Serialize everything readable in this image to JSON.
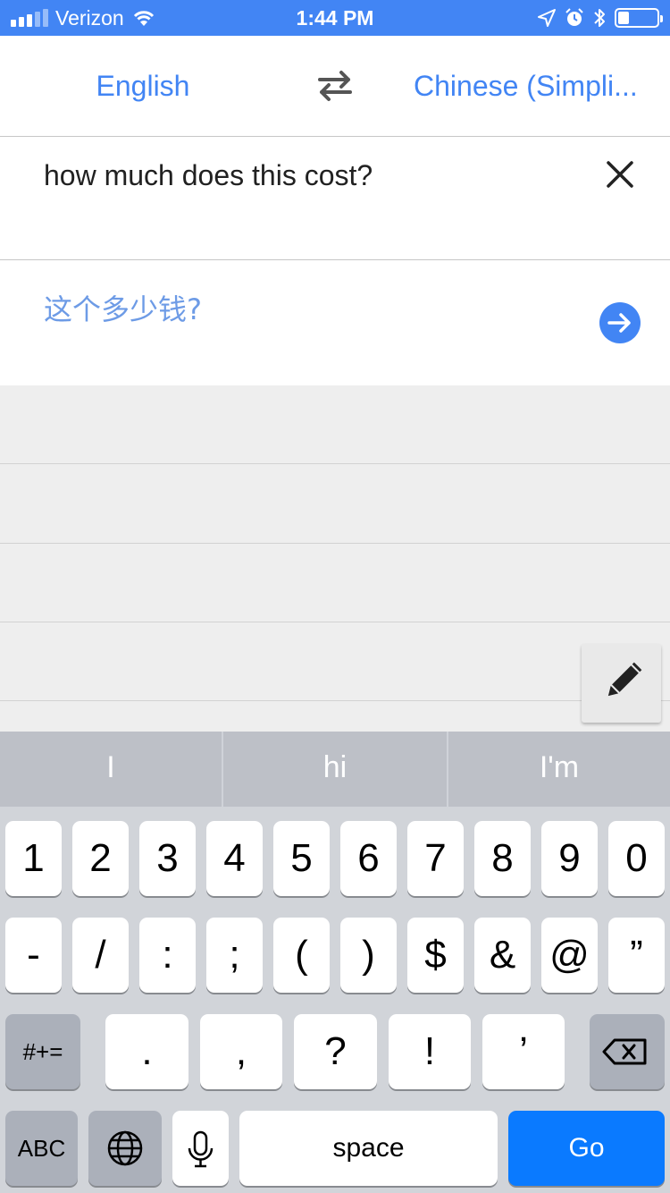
{
  "status_bar": {
    "carrier": "Verizon",
    "time": "1:44 PM"
  },
  "languages": {
    "source": "English",
    "target": "Chinese (Simplified)",
    "target_display": "Chinese (Simpli..."
  },
  "input": {
    "text": "how much does this cost?"
  },
  "result": {
    "text": "这个多少钱?"
  },
  "colors": {
    "accent": "#4285f4",
    "result_text": "#6d9be6",
    "go_key": "#0a7aff"
  },
  "keyboard": {
    "suggestions": [
      "I",
      "hi",
      "I'm"
    ],
    "row1": [
      "1",
      "2",
      "3",
      "4",
      "5",
      "6",
      "7",
      "8",
      "9",
      "0"
    ],
    "row2": [
      "-",
      "/",
      ":",
      ";",
      "(",
      ")",
      "$",
      "&",
      "@",
      "”"
    ],
    "row3": [
      ".",
      ",",
      "?",
      "!",
      "’"
    ],
    "more_symbols": "#+=",
    "abc": "ABC",
    "space": "space",
    "go": "Go"
  },
  "icons": {
    "swap": "swap-languages-icon",
    "clear": "close-icon",
    "go": "arrow-right-icon",
    "handwrite": "pencil-icon",
    "globe": "globe-icon",
    "mic": "microphone-icon",
    "backspace": "backspace-icon"
  }
}
